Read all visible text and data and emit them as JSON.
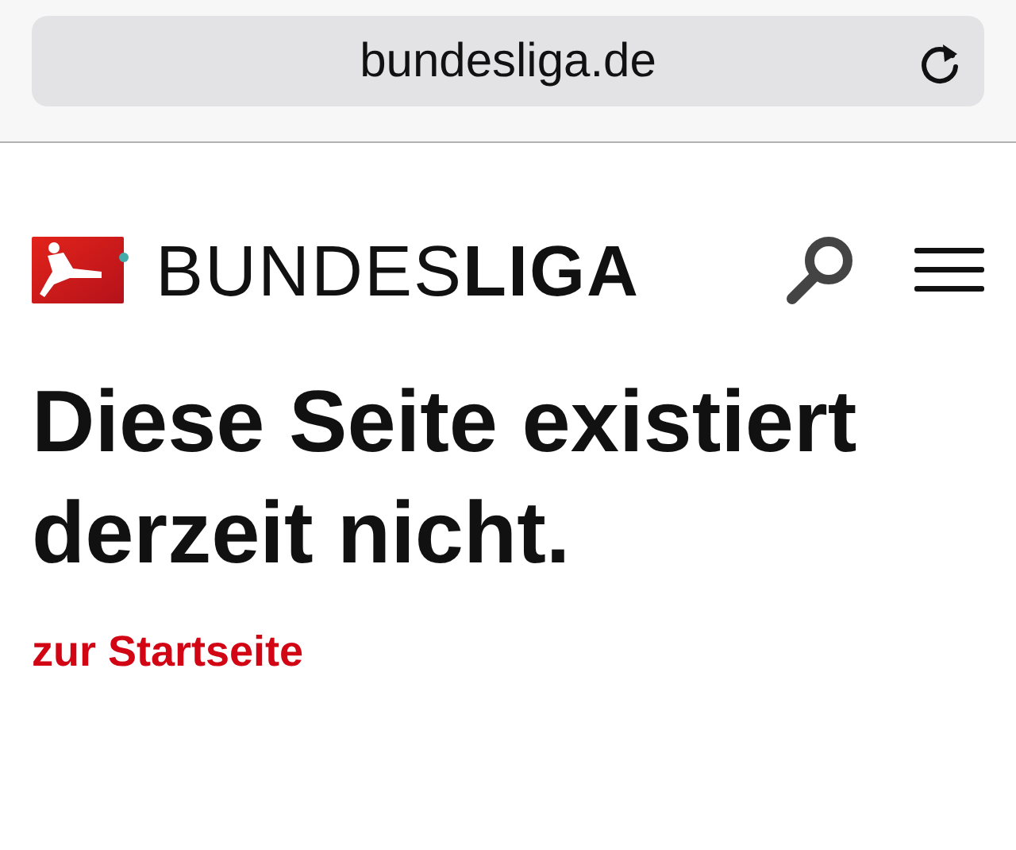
{
  "browser": {
    "url": "bundesliga.de"
  },
  "header": {
    "logo_text": "BUNDES**LIGA**"
  },
  "heading": "Diese Seite existiert derzeit nicht.",
  "link": "zur Startseite"
}
